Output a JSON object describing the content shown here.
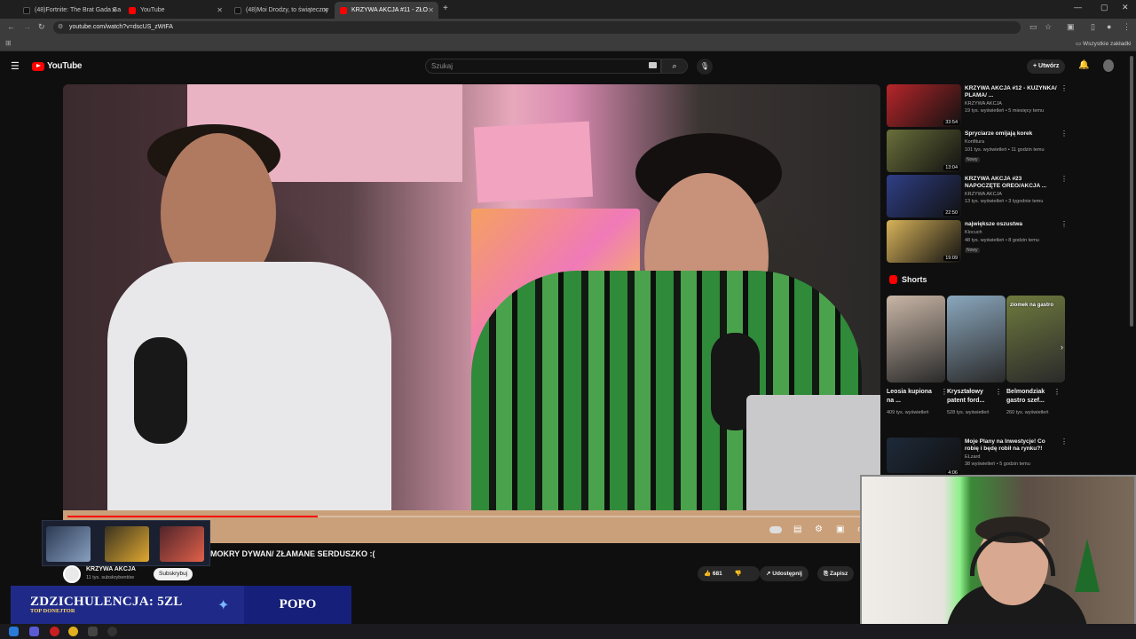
{
  "browser": {
    "tabs": [
      {
        "title": "(48)Fortnite: The Brat Gada Ga",
        "active": false
      },
      {
        "title": "YouTube",
        "active": false
      },
      {
        "title": "(48)Moi Drodzy, to świąteczny",
        "active": false
      },
      {
        "title": "KRZYWA AKCJA #11 - ZŁO",
        "active": true
      }
    ],
    "new_tab": "+",
    "url": "youtube.com/watch?v=dscUS_zWtFA",
    "bookmarks_label": "Wszystkie zakładki"
  },
  "youtube": {
    "logo": "YouTube",
    "search_placeholder": "Szukaj",
    "create_label": "Utwórz",
    "video": {
      "title": "MOKRY DYWAN/ ZŁAMANE SERDUSZKO :(",
      "progress": 0.31,
      "channel": "KRZYWA AKCJA",
      "subscribers": "11 tys. subskrybentów",
      "subscribe_label": "Subskrybuj",
      "likes": "681",
      "share_label": "Udostępnij",
      "save_label": "Zapisz"
    },
    "recommendations": [
      {
        "title": "KRZYWA AKCJA #12 - KUZYNKA/ PLAMA/ ...",
        "channel": "KRZYWA AKCJA",
        "meta": "19 tys. wyświetleń • 5 miesięcy temu",
        "duration": "33:54",
        "badge": "",
        "color": "#b7262a"
      },
      {
        "title": "Spryciarze omijają korek",
        "channel": "Konfitura",
        "meta": "101 tys. wyświetleń • 11 godzin temu",
        "duration": "13:04",
        "badge": "Nowy",
        "color": "#6a6f3a"
      },
      {
        "title": "KRZYWA AKCJA #23 NAPOCZĘTE OREO/AKCJA ...",
        "channel": "KRZYWA AKCJA",
        "meta": "13 tys. wyświetleń • 3 tygodnie temu",
        "duration": "22:50",
        "badge": "",
        "color": "#2f3f86"
      },
      {
        "title": "największe oszustwa",
        "channel": "Klocuch",
        "meta": "48 tys. wyświetleń • 8 godzin temu",
        "duration": "19:09",
        "badge": "Nowy",
        "color": "#d8b35a"
      },
      {
        "title": "Moje Plany na Inwestycje! Co robię i będę robił na rynku?!",
        "channel": "ELzard",
        "meta": "38 wyświetleń • 5 godzin temu",
        "duration": "4:06",
        "badge": "",
        "color": "#1e2a3a"
      }
    ],
    "shorts_label": "Shorts",
    "shorts": [
      {
        "title": "Leosia kupiona na ...",
        "views": "409 tys. wyświetleń",
        "overlay": "",
        "color": "#c9b6a6"
      },
      {
        "title": "Kryształowy patent ford...",
        "views": "528 tys. wyświetleń",
        "overlay": "",
        "color": "#8aa7bd"
      },
      {
        "title": "Belmondziak gastro szef...",
        "views": "260 tys. wyświetleń",
        "overlay": "ziomek na gastro",
        "color": "#6f7a3e"
      }
    ]
  },
  "stream_overlay": {
    "donation_text": "ZDZICHULENCJA: 5ZL",
    "donation_sub": "TOP DONEJTOR",
    "donor_name": "POPO"
  }
}
